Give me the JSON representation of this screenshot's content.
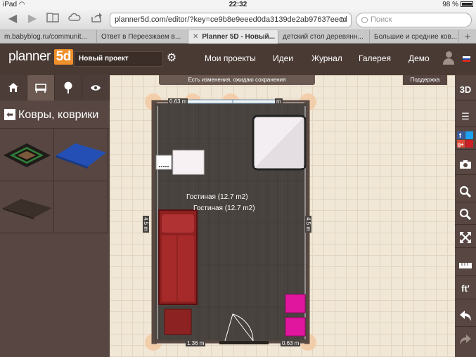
{
  "status_bar": {
    "device": "iPad",
    "time": "22:32",
    "battery": "98 %"
  },
  "browser": {
    "url": "planner5d.com/editor/?key=ce9b8e9eeed0da3139de2ab97637eecd",
    "search_placeholder": "Поиск",
    "tabs": [
      {
        "label": "m.babyblog.ru/communit...",
        "active": false
      },
      {
        "label": "Ответ в Переезжаем в...",
        "active": false
      },
      {
        "label": "Planner 5D - Новый...",
        "active": true
      },
      {
        "label": "детский стол деревянн...",
        "active": false
      },
      {
        "label": "Большие и средние ков...",
        "active": false
      }
    ],
    "add_tab": "+"
  },
  "header": {
    "logo_text": "planner",
    "logo_badge": "5d",
    "project_name": "Новый проект",
    "nav": [
      "Мои проекты",
      "Идеи",
      "Журнал",
      "Галерея",
      "Демо"
    ]
  },
  "left_panel": {
    "category_title": "Ковры, коврики",
    "items": [
      "carpet-dark-square",
      "carpet-blue",
      "carpet-brown"
    ]
  },
  "canvas": {
    "notice": "Есть изменения, ожидаю сохранения",
    "support": "Поддержка",
    "room_labels": [
      "Гостиная (12.7 m2)",
      "Гостиная (12.7 m2)"
    ],
    "dim_top": "0.63 m",
    "dim_top_right": "m",
    "dim_left": "4.5 m",
    "dim_right": "4.5 m",
    "dim_bottom_left": "1.36 m",
    "dim_bottom_right": "0.63 m"
  },
  "right_toolbar": {
    "view3d": "3D",
    "units": "ft'"
  },
  "colors": {
    "header_bg": "#4a3a34",
    "panel_bg": "#574641",
    "accent": "#f0902a",
    "floor": "#4a4541",
    "bed": "#8e2020",
    "cube": "#e0169e"
  }
}
